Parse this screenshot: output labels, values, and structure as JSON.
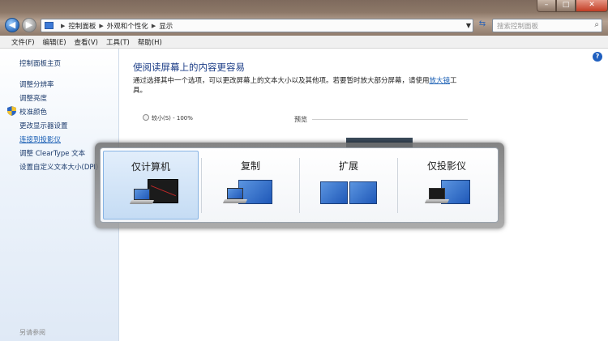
{
  "titlebar": {
    "breadcrumbs": [
      "控制面板",
      "外观和个性化",
      "显示"
    ],
    "search_placeholder": "搜索控制面板",
    "min": "–",
    "max": "□",
    "close": "✕"
  },
  "menu": [
    "文件(F)",
    "编辑(E)",
    "查看(V)",
    "工具(T)",
    "帮助(H)"
  ],
  "sidebar": {
    "home": "控制面板主页",
    "items": [
      "调整分辨率",
      "调整亮度",
      "校准颜色",
      "更改显示器设置",
      "连接到投影仪",
      "调整 ClearType 文本",
      "设置自定义文本大小(DPI)"
    ],
    "active_index": 4,
    "see_also": "另请参阅"
  },
  "main": {
    "heading": "使阅读屏幕上的内容更容易",
    "desc_before": "通过选择其中一个选项，可以更改屏幕上的文本大小以及其他项。若要暂时放大部分屏幕，请使用",
    "desc_link": "放大镜",
    "desc_after": "工具。",
    "option_small": "较小(S) - 100%",
    "preview_label": "预览"
  },
  "projection": {
    "options": [
      "仅计算机",
      "复制",
      "扩展",
      "仅投影仪"
    ],
    "selected": 0
  },
  "colors": {
    "accent": "#1a5fb4",
    "selection": "#c5dcf4"
  }
}
